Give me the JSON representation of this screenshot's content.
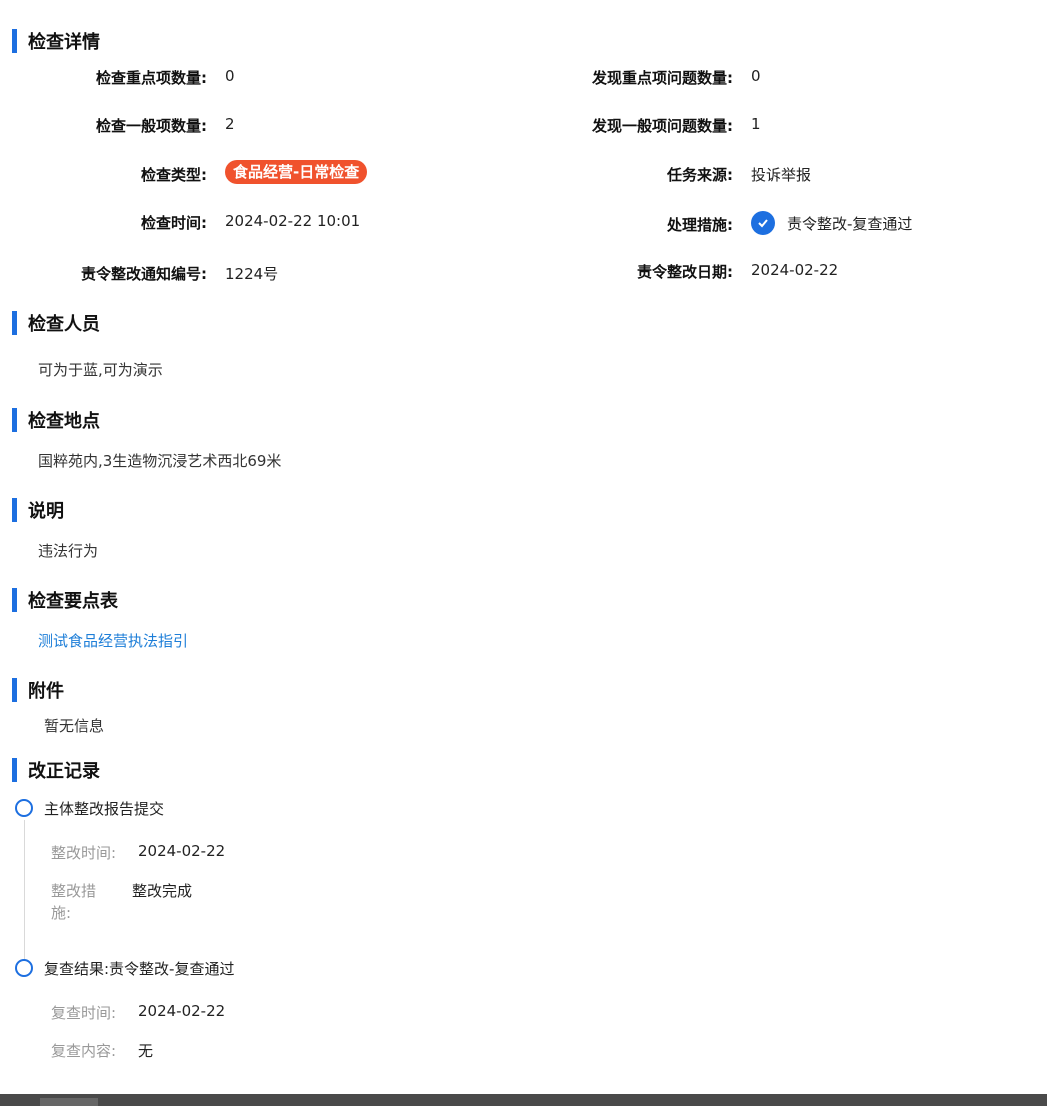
{
  "sections": {
    "details": "检查详情",
    "inspectors": "检查人员",
    "location": "检查地点",
    "description": "说明",
    "checklist": "检查要点表",
    "attachments": "附件",
    "correction_records": "改正记录"
  },
  "details": {
    "key_items_count_label": "检查重点项数量:",
    "key_items_count_value": "0",
    "key_issues_label": "发现重点项问题数量:",
    "key_issues_value": "0",
    "general_items_count_label": "检查一般项数量:",
    "general_items_count_value": "2",
    "general_issues_label": "发现一般项问题数量:",
    "general_issues_value": "1",
    "type_label": "检查类型:",
    "type_value": "食品经营-日常检查",
    "source_label": "任务来源:",
    "source_value": "投诉举报",
    "time_label": "检查时间:",
    "time_value": "2024-02-22 10:01",
    "measure_label": "处理措施:",
    "measure_value": "责令整改-复查通过",
    "notice_no_label": "责令整改通知编号:",
    "notice_no_value": "1224号",
    "rectify_date_label": "责令整改日期:",
    "rectify_date_value": "2024-02-22"
  },
  "inspectors_value": "可为于蓝,可为演示",
  "location_value": "国粹苑内,3生造物沉浸艺术西北69米",
  "description_value": "违法行为",
  "checklist_link": "测试食品经营执法指引",
  "attachments_value": "暂无信息",
  "timeline": {
    "item1_title": "主体整改报告提交",
    "item1_time_label": "整改时间:",
    "item1_time_value": "2024-02-22",
    "item1_measure_label_a": "整改措",
    "item1_measure_label_b": "施:",
    "item1_measure_value": "整改完成",
    "item2_title": "复查结果:责令整改-复查通过",
    "item2_time_label": "复查时间:",
    "item2_time_value": "2024-02-22",
    "item2_content_label": "复查内容:",
    "item2_content_value": "无"
  },
  "colors": {
    "accent": "#1d6fe0",
    "tag": "#f0522d",
    "link": "#1d7ed8"
  }
}
